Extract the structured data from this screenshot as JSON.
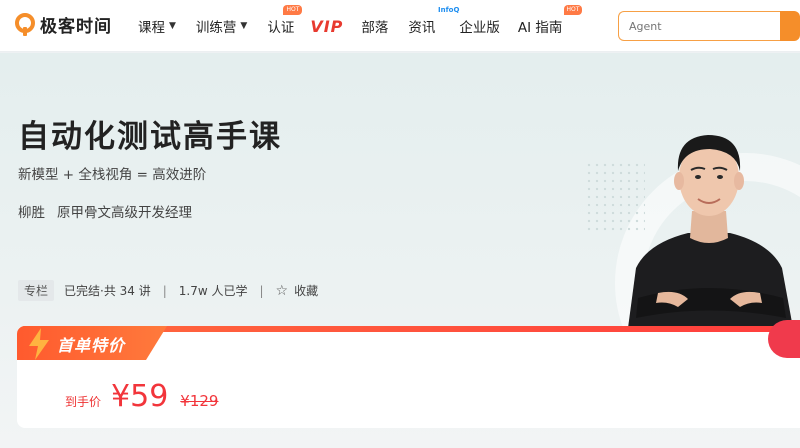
{
  "header": {
    "logo_text": "极客时间",
    "nav": [
      {
        "label": "课程",
        "dropdown": true
      },
      {
        "label": "训练营",
        "dropdown": true
      },
      {
        "label": "认证",
        "badge": "HOT"
      },
      {
        "label": "VIP"
      },
      {
        "label": "部落"
      },
      {
        "label": "资讯",
        "badge": "InfoQ"
      },
      {
        "label": "企业版"
      },
      {
        "label": "AI 指南",
        "badge": "HOT"
      }
    ],
    "search": {
      "placeholder": "Agent"
    }
  },
  "course": {
    "title": "自动化测试高手课",
    "subtitle": "新模型 + 全栈视角 = 高效进阶",
    "author_name": "柳胜",
    "author_role": "原甲骨文高级开发经理",
    "tag": "专栏",
    "status": "已完结·共 34 讲",
    "learners": "1.7w 人已学",
    "favorite_label": "收藏"
  },
  "promo": {
    "tab_label": "首单特价",
    "price_label": "到手价",
    "price": "¥59",
    "original_price": "¥129"
  },
  "colors": {
    "accent": "#f58e2a",
    "price_red": "#f2353b",
    "vip_red": "#e83a2f"
  }
}
